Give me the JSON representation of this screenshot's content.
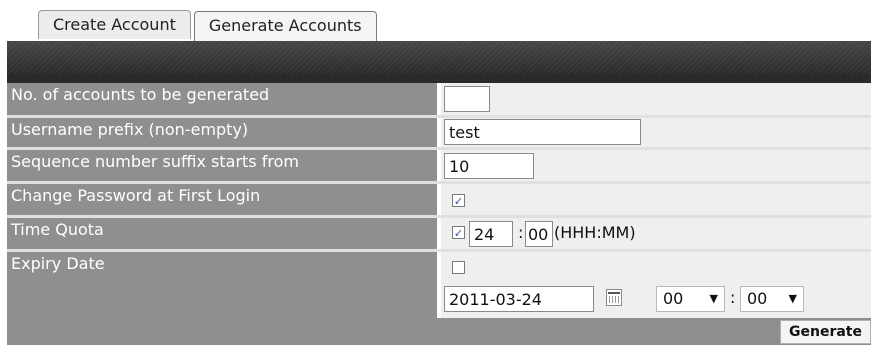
{
  "tabs": [
    {
      "label": "Create Account",
      "active": false
    },
    {
      "label": "Generate Accounts",
      "active": true
    }
  ],
  "form": {
    "accounts_count": {
      "label": "No. of accounts to be generated",
      "value": ""
    },
    "username_prefix": {
      "label": "Username prefix (non-empty)",
      "value": "test"
    },
    "sequence_start": {
      "label": "Sequence number suffix starts from",
      "value": "10"
    },
    "change_password": {
      "label": "Change Password at First Login",
      "checked": true
    },
    "time_quota": {
      "label": "Time Quota",
      "checked": true,
      "hours": "24",
      "minutes": "00",
      "separator": ":",
      "format_hint": "(HHH:MM)"
    },
    "expiry_date": {
      "label": "Expiry Date",
      "checked": false,
      "date": "2011-03-24",
      "hour": "00",
      "minute": "00",
      "separator": ":"
    }
  },
  "footer": {
    "generate_label": "Generate"
  },
  "icons": {
    "calendar": "calendar-icon",
    "dropdown": "chevron-down-icon",
    "checkbox_check": "checkmark"
  }
}
